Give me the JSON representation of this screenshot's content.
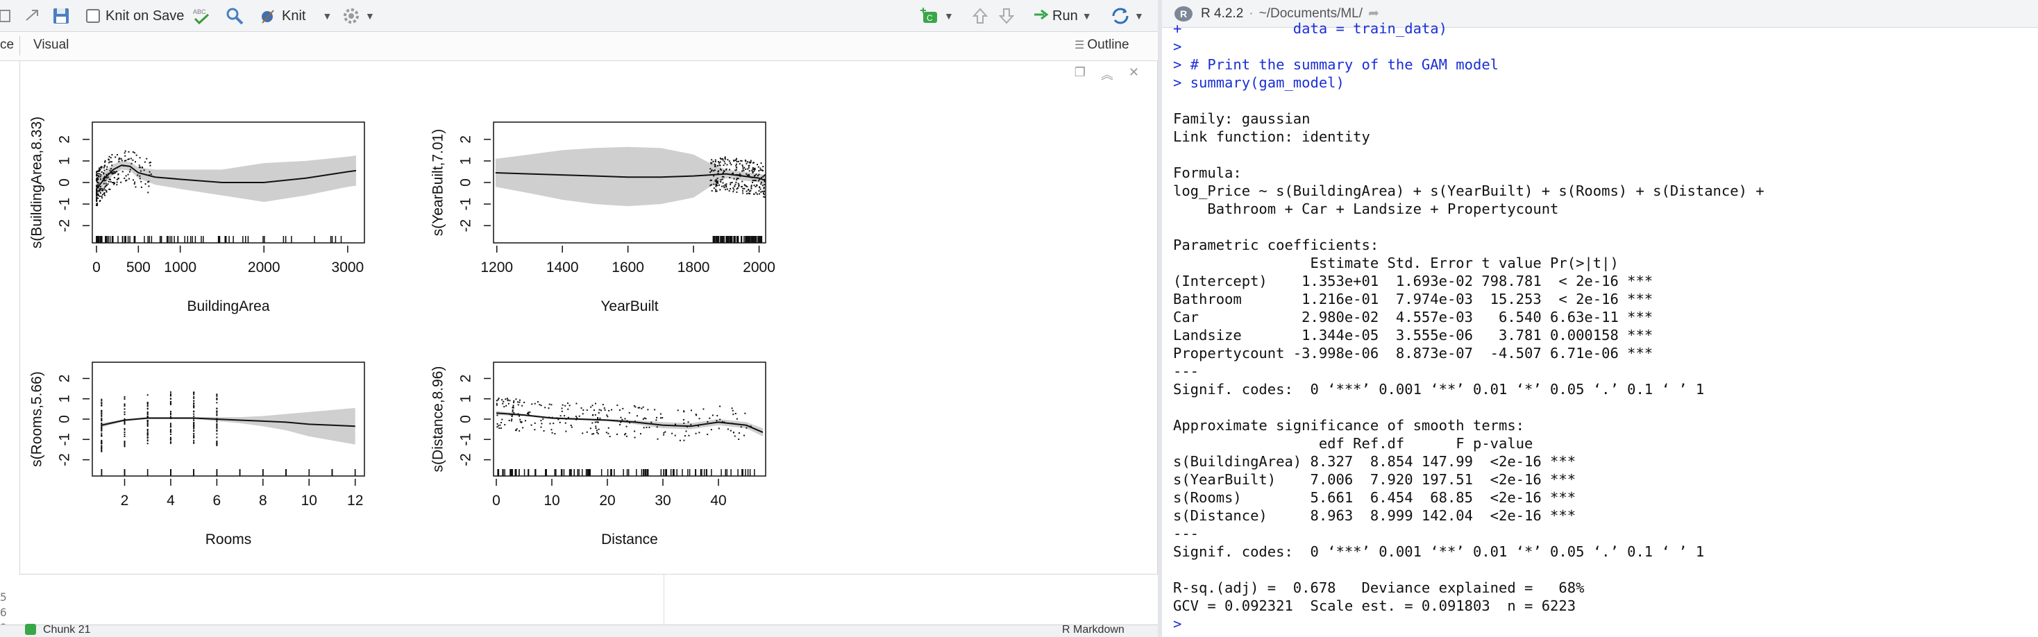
{
  "toolbar": {
    "knit_on_save": "Knit on Save",
    "knit": "Knit",
    "run": "Run"
  },
  "subbar": {
    "source_tab": "ce",
    "visual_tab": "Visual",
    "outline": "Outline"
  },
  "line_numbers": [
    "5",
    "6",
    "9"
  ],
  "status": {
    "chunk": "Chunk 21",
    "mode": "R Markdown"
  },
  "console": {
    "r_version": "R 4.2.2",
    "path": "~/Documents/ML/",
    "lines": [
      {
        "t": "+             data = train_data)",
        "c": "blue"
      },
      {
        "t": ">",
        "c": "blue"
      },
      {
        "t": "> # Print the summary of the GAM model",
        "c": "blue"
      },
      {
        "t": "> summary(gam_model)",
        "c": "blue"
      },
      {
        "t": "",
        "c": "black"
      },
      {
        "t": "Family: gaussian",
        "c": "black"
      },
      {
        "t": "Link function: identity",
        "c": "black"
      },
      {
        "t": "",
        "c": "black"
      },
      {
        "t": "Formula:",
        "c": "black"
      },
      {
        "t": "log_Price ~ s(BuildingArea) + s(YearBuilt) + s(Rooms) + s(Distance) +",
        "c": "black"
      },
      {
        "t": "    Bathroom + Car + Landsize + Propertycount",
        "c": "black"
      },
      {
        "t": "",
        "c": "black"
      },
      {
        "t": "Parametric coefficients:",
        "c": "black"
      },
      {
        "t": "                Estimate Std. Error t value Pr(>|t|)    ",
        "c": "black"
      },
      {
        "t": "(Intercept)    1.353e+01  1.693e-02 798.781  < 2e-16 ***",
        "c": "black"
      },
      {
        "t": "Bathroom       1.216e-01  7.974e-03  15.253  < 2e-16 ***",
        "c": "black"
      },
      {
        "t": "Car            2.980e-02  4.557e-03   6.540 6.63e-11 ***",
        "c": "black"
      },
      {
        "t": "Landsize       1.344e-05  3.555e-06   3.781 0.000158 ***",
        "c": "black"
      },
      {
        "t": "Propertycount -3.998e-06  8.873e-07  -4.507 6.71e-06 ***",
        "c": "black"
      },
      {
        "t": "---",
        "c": "black"
      },
      {
        "t": "Signif. codes:  0 ‘***’ 0.001 ‘**’ 0.01 ‘*’ 0.05 ‘.’ 0.1 ‘ ’ 1",
        "c": "black"
      },
      {
        "t": "",
        "c": "black"
      },
      {
        "t": "Approximate significance of smooth terms:",
        "c": "black"
      },
      {
        "t": "                 edf Ref.df      F p-value    ",
        "c": "black"
      },
      {
        "t": "s(BuildingArea) 8.327  8.854 147.99  <2e-16 ***",
        "c": "black"
      },
      {
        "t": "s(YearBuilt)    7.006  7.920 197.51  <2e-16 ***",
        "c": "black"
      },
      {
        "t": "s(Rooms)        5.661  6.454  68.85  <2e-16 ***",
        "c": "black"
      },
      {
        "t": "s(Distance)     8.963  8.999 142.04  <2e-16 ***",
        "c": "black"
      },
      {
        "t": "---",
        "c": "black"
      },
      {
        "t": "Signif. codes:  0 ‘***’ 0.001 ‘**’ 0.01 ‘*’ 0.05 ‘.’ 0.1 ‘ ’ 1",
        "c": "black"
      },
      {
        "t": "",
        "c": "black"
      },
      {
        "t": "R-sq.(adj) =  0.678   Deviance explained =   68%",
        "c": "black"
      },
      {
        "t": "GCV = 0.092321  Scale est. = 0.091803  n = 6223",
        "c": "black"
      },
      {
        "t": ">",
        "c": "blue"
      }
    ]
  },
  "chart_data": [
    {
      "type": "line",
      "xlabel": "BuildingArea",
      "ylabel": "s(BuildingArea,8.33)",
      "xticks": [
        0,
        500,
        1000,
        2000,
        3000
      ],
      "yticks": [
        -2,
        -1,
        0,
        1,
        2
      ],
      "xlim": [
        -50,
        3200
      ],
      "ylim": [
        -2.8,
        2.8
      ],
      "x": [
        0,
        100,
        200,
        300,
        400,
        500,
        700,
        1000,
        1500,
        2000,
        2500,
        3000,
        3100
      ],
      "y": [
        -0.3,
        0.2,
        0.6,
        0.8,
        0.75,
        0.45,
        0.25,
        0.15,
        0.0,
        0.0,
        0.2,
        0.5,
        0.55
      ],
      "band_upper": [
        0.1,
        0.5,
        0.85,
        1.0,
        0.95,
        0.7,
        0.6,
        0.6,
        0.6,
        0.9,
        1.0,
        1.2,
        1.25
      ],
      "band_lower": [
        -0.7,
        -0.1,
        0.35,
        0.6,
        0.55,
        0.2,
        -0.1,
        -0.3,
        -0.6,
        -0.9,
        -0.6,
        -0.2,
        -0.15
      ]
    },
    {
      "type": "line",
      "xlabel": "YearBuilt",
      "ylabel": "s(YearBuilt,7.01)",
      "xticks": [
        1200,
        1400,
        1600,
        1800,
        2000
      ],
      "yticks": [
        -2,
        -1,
        0,
        1,
        2
      ],
      "xlim": [
        1190,
        2020
      ],
      "ylim": [
        -2.8,
        2.8
      ],
      "x": [
        1196,
        1300,
        1400,
        1500,
        1600,
        1700,
        1800,
        1850,
        1900,
        1950,
        2000,
        2018
      ],
      "y": [
        0.45,
        0.4,
        0.35,
        0.3,
        0.25,
        0.25,
        0.3,
        0.35,
        0.4,
        0.3,
        0.2,
        0.1
      ],
      "band_upper": [
        1.1,
        1.3,
        1.5,
        1.6,
        1.65,
        1.6,
        1.3,
        0.9,
        0.6,
        0.5,
        0.4,
        0.35
      ],
      "band_lower": [
        -0.2,
        -0.5,
        -0.8,
        -1.0,
        -1.1,
        -1.0,
        -0.7,
        -0.2,
        0.2,
        0.1,
        0.0,
        -0.15
      ]
    },
    {
      "type": "line",
      "xlabel": "Rooms",
      "ylabel": "s(Rooms,5.66)",
      "xticks": [
        2,
        4,
        6,
        8,
        10,
        12
      ],
      "yticks": [
        -2,
        -1,
        0,
        1,
        2
      ],
      "xlim": [
        0.6,
        12.4
      ],
      "ylim": [
        -2.8,
        2.8
      ],
      "x": [
        1,
        2,
        3,
        4,
        5,
        6,
        7,
        8,
        9,
        10,
        11,
        12
      ],
      "y": [
        -0.3,
        -0.05,
        0.05,
        0.05,
        0.05,
        0.0,
        -0.05,
        -0.1,
        -0.15,
        -0.25,
        -0.3,
        -0.35
      ],
      "band_upper": [
        -0.2,
        0.0,
        0.1,
        0.1,
        0.1,
        0.1,
        0.1,
        0.15,
        0.25,
        0.35,
        0.45,
        0.55
      ],
      "band_lower": [
        -0.4,
        -0.1,
        0.0,
        0.0,
        0.0,
        -0.1,
        -0.2,
        -0.35,
        -0.55,
        -0.85,
        -1.05,
        -1.25
      ]
    },
    {
      "type": "line",
      "xlabel": "Distance",
      "ylabel": "s(Distance,8.96)",
      "xticks": [
        0,
        10,
        20,
        30,
        40
      ],
      "yticks": [
        -2,
        -1,
        0,
        1,
        2
      ],
      "xlim": [
        -0.5,
        48.5
      ],
      "ylim": [
        -2.8,
        2.8
      ],
      "x": [
        0,
        5,
        10,
        15,
        20,
        25,
        30,
        35,
        40,
        45,
        48
      ],
      "y": [
        0.3,
        0.2,
        0.05,
        0.0,
        -0.05,
        -0.15,
        -0.3,
        -0.35,
        -0.15,
        -0.3,
        -0.65
      ],
      "band_upper": [
        0.4,
        0.25,
        0.1,
        0.05,
        0.0,
        -0.05,
        -0.15,
        -0.2,
        0.0,
        -0.15,
        -0.45
      ],
      "band_lower": [
        0.2,
        0.15,
        0.0,
        -0.05,
        -0.1,
        -0.25,
        -0.45,
        -0.5,
        -0.3,
        -0.45,
        -0.85
      ]
    }
  ]
}
